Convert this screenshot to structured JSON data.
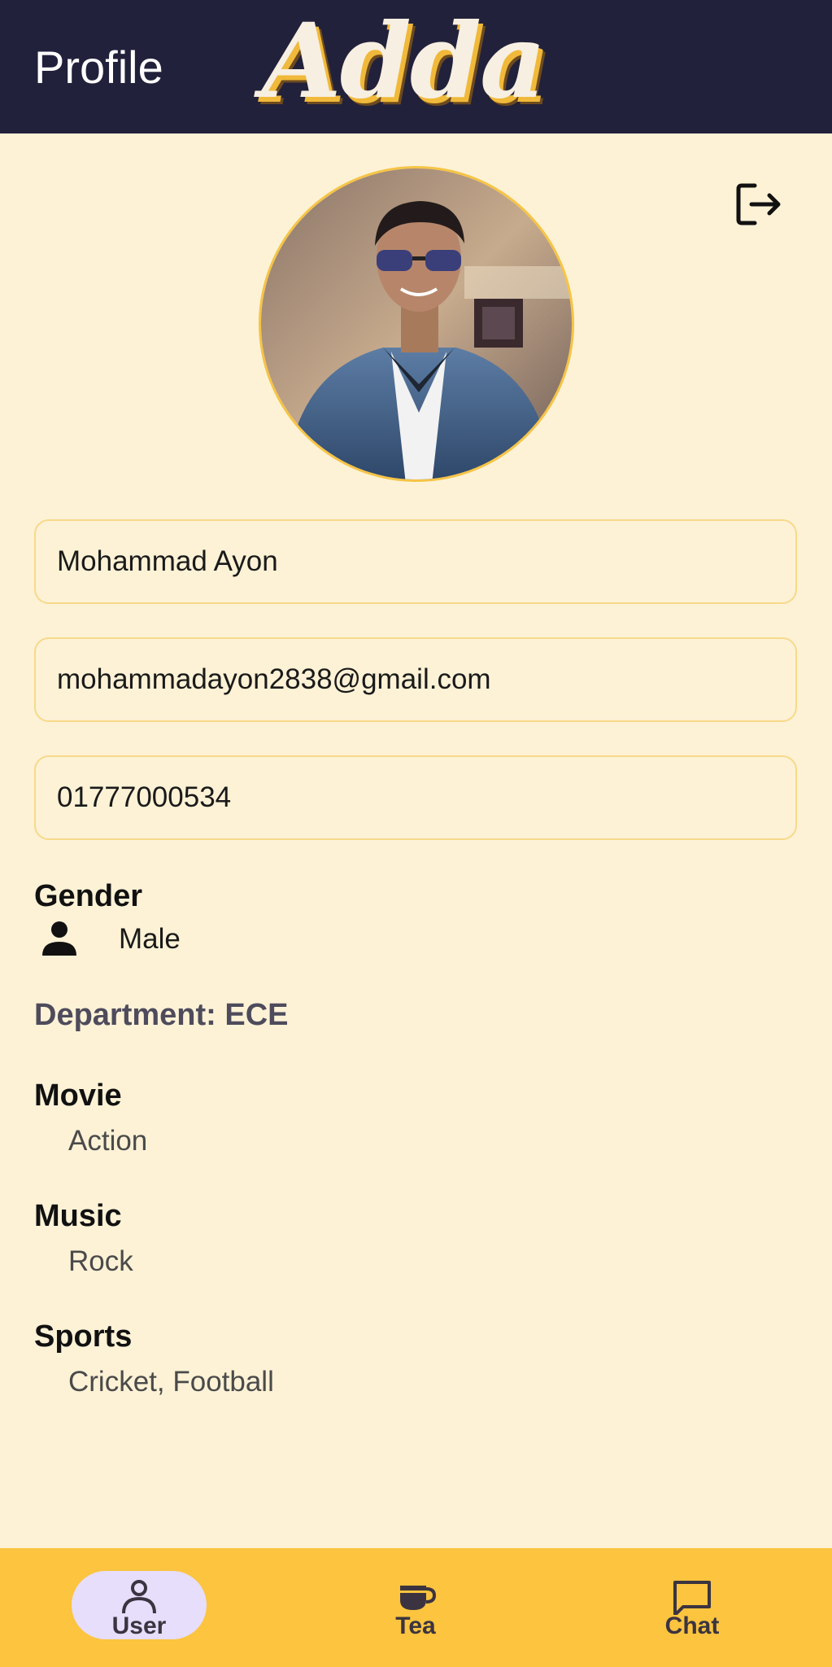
{
  "app_bar": {
    "title": "Profile",
    "logo_text": "Adda"
  },
  "profile": {
    "name": "Mohammad Ayon",
    "email": "mohammadayon2838@gmail.com",
    "phone": "01777000534",
    "gender_label": "Gender",
    "gender_value": "Male",
    "department": "Department: ECE",
    "movie_label": "Movie",
    "movie_value": "Action",
    "music_label": "Music",
    "music_value": "Rock",
    "sports_label": "Sports",
    "sports_value": "Cricket, Football"
  },
  "bottom_nav": {
    "items": [
      {
        "label": "User",
        "icon": "user-icon",
        "active": true
      },
      {
        "label": "Tea",
        "icon": "tea-cup-icon",
        "active": false
      },
      {
        "label": "Chat",
        "icon": "chat-icon",
        "active": false
      }
    ]
  },
  "colors": {
    "app_bar_bg": "#22213b",
    "page_bg": "#fdf2d6",
    "nav_bg": "#fcc43f",
    "active_pill": "#e6defa",
    "field_border": "#f7d98a",
    "logo_accent": "#f0b93a"
  }
}
